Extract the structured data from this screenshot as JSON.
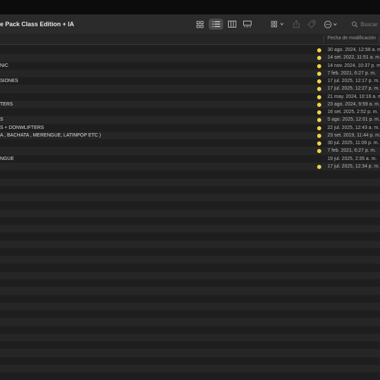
{
  "window": {
    "title": "e Pack Class Edition + IA"
  },
  "toolbar": {
    "view_buttons": [
      "icon-view",
      "list-view",
      "column-view",
      "gallery-view"
    ],
    "search_placeholder": "Buscar"
  },
  "colors": {
    "tag_yellow": "#f1d34a",
    "row_odd": "#1e1e1e",
    "row_even": "#262626"
  },
  "header": {
    "date_column": "Fecha de modificación"
  },
  "files": [
    {
      "name": "",
      "date": "30 ago. 2024, 12:58 a. m.",
      "tag": true
    },
    {
      "name": "",
      "date": "14 set. 2022, 11:51 a. m.",
      "tag": true
    },
    {
      "name": "NIC",
      "date": "14 nov. 2024, 10:37 p. m.",
      "tag": true
    },
    {
      "name": "",
      "date": "7 feb. 2021, 6:27 p. m.",
      "tag": true
    },
    {
      "name": "SIONES",
      "date": "17 jul. 2025, 12:17 p. m.",
      "tag": true
    },
    {
      "name": "",
      "date": "17 jul. 2025, 12:27 p. m.",
      "tag": true
    },
    {
      "name": "",
      "date": "21 may. 2024, 10:16 a. m.",
      "tag": true
    },
    {
      "name": "TERS",
      "date": "23 ago. 2024, 9:59 a. m.",
      "tag": true
    },
    {
      "name": "",
      "date": "16 set. 2025, 2:52 p. m.",
      "tag": true
    },
    {
      "name": "S",
      "date": "5 ago. 2025, 12:01 p. m.",
      "tag": true
    },
    {
      "name": "S + DONWLIFTERS",
      "date": "22 jul. 2025, 12:43 a. m.",
      "tag": true
    },
    {
      "name": "A , BACHATA , MERENGUE, LATINPOP ETC )",
      "date": "23 set. 2019, 11:44 p. m.",
      "tag": true
    },
    {
      "name": "",
      "date": "30 jul. 2025, 11:06 p. m.",
      "tag": true
    },
    {
      "name": "",
      "date": "7 feb. 2021, 6:27 p. m.",
      "tag": true
    },
    {
      "name": "NGUE",
      "date": "19 jul. 2025, 2:35 a. m.",
      "tag": false
    },
    {
      "name": "",
      "date": "17 jul. 2025, 12:34 p. m.",
      "tag": true
    }
  ]
}
